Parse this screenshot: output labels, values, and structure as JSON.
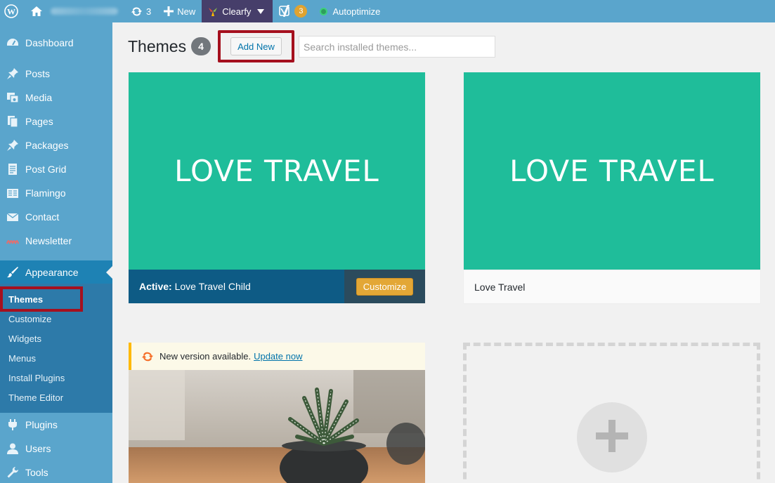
{
  "adminbar": {
    "updates_count": "3",
    "new_label": "New",
    "clearfy_label": "Clearfy",
    "yoast_count": "3",
    "autoptimize_label": "Autoptimize"
  },
  "sidebar": {
    "items": [
      {
        "label": "Dashboard",
        "icon": "dashboard-icon"
      },
      {
        "label": "Posts",
        "icon": "pin-icon"
      },
      {
        "label": "Media",
        "icon": "media-icon"
      },
      {
        "label": "Pages",
        "icon": "pages-icon"
      },
      {
        "label": "Packages",
        "icon": "pin-icon"
      },
      {
        "label": "Post Grid",
        "icon": "grid-icon"
      },
      {
        "label": "Flamingo",
        "icon": "flamingo-icon"
      },
      {
        "label": "Contact",
        "icon": "mail-icon"
      },
      {
        "label": "Newsletter",
        "icon": "newsletter-icon"
      },
      {
        "label": "Appearance",
        "icon": "brush-icon"
      }
    ],
    "submenu": [
      "Themes",
      "Customize",
      "Widgets",
      "Menus",
      "Install Plugins",
      "Theme Editor"
    ],
    "items_bottom": [
      {
        "label": "Plugins",
        "icon": "plugin-icon"
      },
      {
        "label": "Users",
        "icon": "user-icon"
      },
      {
        "label": "Tools",
        "icon": "wrench-icon"
      }
    ]
  },
  "header": {
    "title": "Themes",
    "count": "4",
    "add_new": "Add New",
    "search_placeholder": "Search installed themes..."
  },
  "themes": [
    {
      "screenshot_text": "LOVE TRAVEL",
      "active_label": "Active:",
      "name": "Love Travel Child",
      "action": "Customize"
    },
    {
      "screenshot_text": "LOVE TRAVEL",
      "name": "Love Travel"
    },
    {
      "notice": "New version available.",
      "notice_link": "Update now"
    }
  ],
  "colors": {
    "sidebar": "#5aa5cc",
    "theme_bg": "#1fbd9a",
    "active_bar": "#0e5b85",
    "customize": "#e3a736",
    "highlight": "#a5101e"
  }
}
